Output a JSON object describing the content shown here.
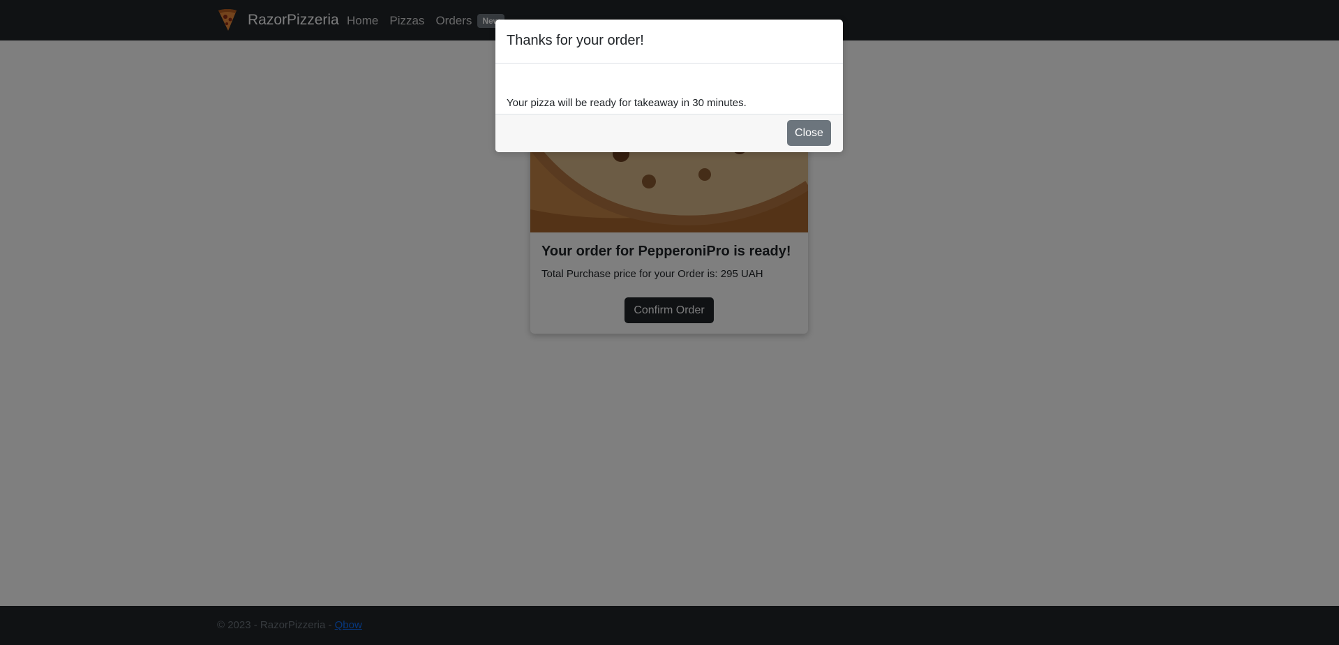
{
  "navbar": {
    "brand": "RazorPizzeria",
    "links": [
      "Home",
      "Pizzas",
      "Orders"
    ],
    "badge": "New",
    "logo_icon": "pizza-slice-icon",
    "background": "#212529"
  },
  "card": {
    "image_icon": "pizza-photo",
    "title": "Your order for PepperoniPro is ready!",
    "text": "Total Purchase price for your Order is: 295 UAH",
    "button": "Confirm Order"
  },
  "footer": {
    "text": "© 2023 - RazorPizzeria - ",
    "link": "Qbow"
  },
  "modal": {
    "title": "Thanks for your order!",
    "body": "Your pizza will be ready for takeaway in 30 minutes.",
    "close_button": "Close",
    "close_button_color": "#6c757d"
  }
}
